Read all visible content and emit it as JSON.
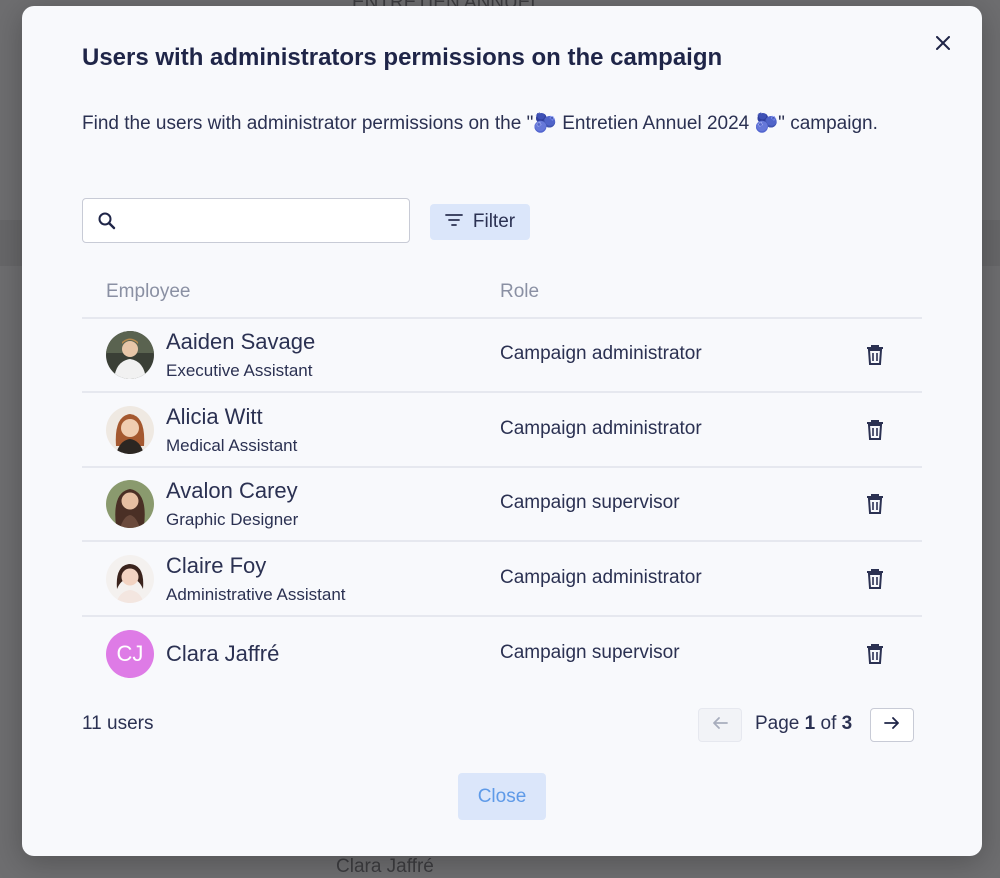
{
  "modal": {
    "title": "Users with administrators permissions on the campaign",
    "description": "Find the users with administrator permissions on the \"🫐 Entretien Annuel 2024 🫐\" campaign.",
    "search_placeholder": "",
    "filter_label": "Filter",
    "columns": {
      "employee": "Employee",
      "role": "Role"
    },
    "rows": [
      {
        "name": "Aaiden Savage",
        "job": "Executive Assistant",
        "role": "Campaign administrator",
        "avatar": "photo"
      },
      {
        "name": "Alicia Witt",
        "job": "Medical Assistant",
        "role": "Campaign administrator",
        "avatar": "photo"
      },
      {
        "name": "Avalon Carey",
        "job": "Graphic Designer",
        "role": "Campaign supervisor",
        "avatar": "photo"
      },
      {
        "name": "Claire Foy",
        "job": "Administrative Assistant",
        "role": "Campaign administrator",
        "avatar": "photo"
      },
      {
        "name": "Clara Jaffré",
        "job": "",
        "role": "Campaign supervisor",
        "avatar": "initials",
        "initials": "CJ"
      }
    ],
    "user_count": "11 users",
    "pagination": {
      "prefix": "Page",
      "current": "1",
      "of": "of",
      "total": "3"
    },
    "close_label": "Close"
  },
  "background": {
    "top_tab": "ENTRETIEN ANNUEL",
    "bottom_name": "Clara Jaffré"
  },
  "colors": {
    "accent": "#5e9ae8",
    "button_bg": "#dbe6fa",
    "initials_avatar": "#de7be6",
    "text": "#1f2548"
  }
}
